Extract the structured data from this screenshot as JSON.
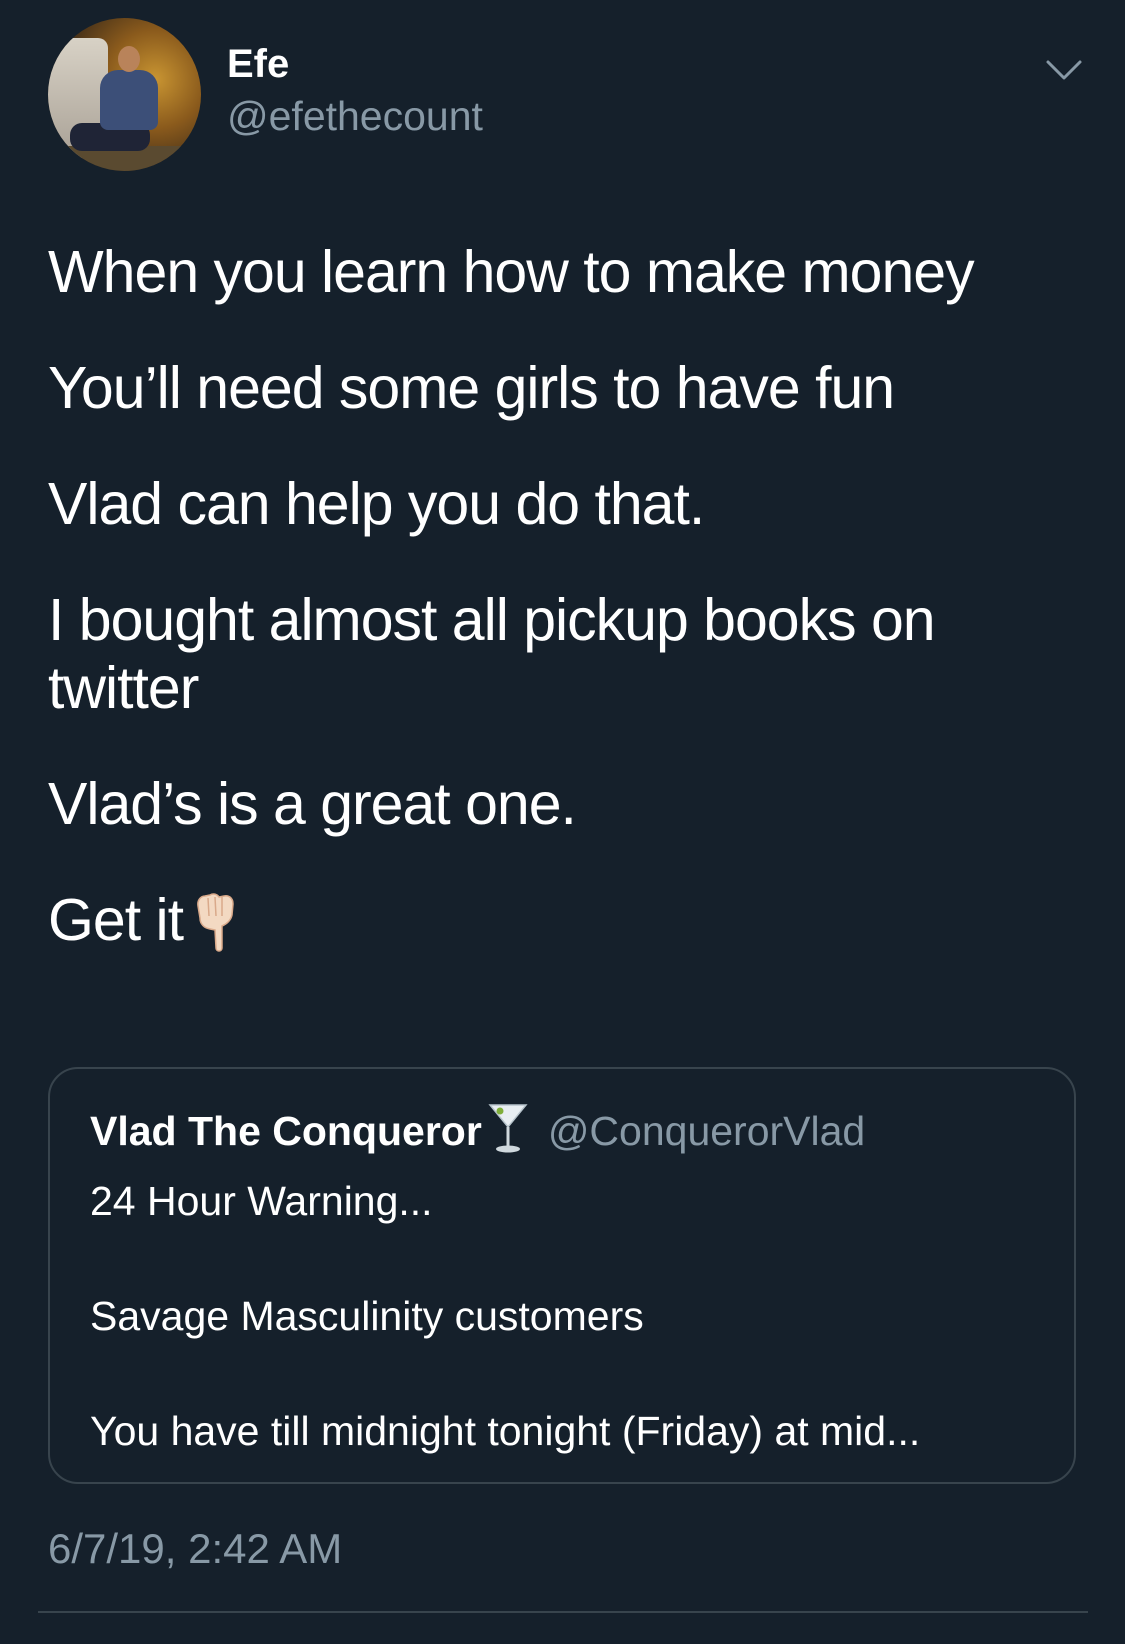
{
  "author": {
    "name": "Efe",
    "handle": "@efethecount"
  },
  "tweet": {
    "lines": [
      "When you learn how to make money",
      "You’ll need some girls to have fun",
      "Vlad can help you do that.",
      "I bought almost all pickup books on twitter",
      "Vlad’s is a great one.",
      "Get it"
    ],
    "emoji": "backhand-index-pointing-down"
  },
  "quoted_tweet": {
    "name": "Vlad The Conqueror",
    "name_emoji": "cocktail-glass",
    "handle": "@ConquerorVlad",
    "line_1": "24 Hour Warning...",
    "line_2": "Savage Masculinity customers",
    "line_3": "You have till midnight tonight (Friday) at mid..."
  },
  "timestamp": "6/7/19, 2:42 AM",
  "colors": {
    "background": "#15202b",
    "primary_text": "#ffffff",
    "secondary_text": "#8899a6",
    "border": "#38444d"
  },
  "icons": {
    "menu": "chevron-down-icon",
    "avatar": "user-avatar-photo"
  }
}
